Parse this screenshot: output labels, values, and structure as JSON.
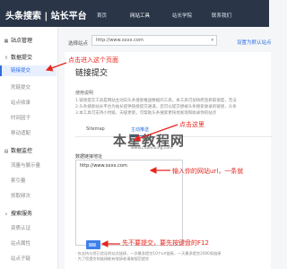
{
  "header": {
    "brand": "头条搜索 | 站长平台",
    "nav": [
      "首页",
      "网站工具",
      "站长学院",
      "联系我们"
    ],
    "active_nav": 1
  },
  "sidebar": {
    "sections": [
      {
        "label": "站点管理",
        "icon": "grid-icon"
      },
      {
        "label": "数据提交",
        "icon": "upload-icon",
        "items": [
          "链接提交",
          "死链提交",
          "站点收录",
          "时间因子",
          "移动适配"
        ]
      },
      {
        "label": "数据监控",
        "icon": "chart-icon",
        "items": [
          "流量与展示量",
          "索引量",
          "抓取频次"
        ]
      },
      {
        "label": "搜索服务",
        "icon": "search-icon",
        "items": [
          "资质认证",
          "站点属性",
          "站点子链"
        ]
      }
    ]
  },
  "site_bar": {
    "label": "选择站点",
    "value": "http://www.xxxx.com",
    "link": "设置为默认站点"
  },
  "page": {
    "title": "链接提交",
    "usage_label": "使用说明",
    "usage_lines": [
      "1.链接提交工具是网站主动向头条搜索推送数据的工具，本工具可加快爬虫抓取速度，无法",
      "2.头条搜索站长平台为站长提供链接提交通道，您可以提交想被头条搜索收录的链接，头条",
      "3.本工具可支持小时级、天级更新，可帮助头条搜索更快地发现和收录你的站点"
    ],
    "tabs": [
      "Sitemap",
      "主动推送"
    ],
    "input_label": "数据链接地址",
    "url_value": "http://www.xxxx.com",
    "notes": [
      "· 仅支持与您已验证的站点链接，一次最多提交10个url链接，一天最多提交2000条链接",
      "· 为了您提交的链接能有效接收请按规范提交"
    ],
    "watermark": "本星教程网",
    "watermark_sub": "www.cnbenxing.com"
  },
  "annotations": {
    "step1": "点击进入这个页面",
    "step2": "点击这里",
    "step3": "输入你的网站url，一条就",
    "step4": "先不要提交，要先按键盘的F12",
    "color": "#e8251c"
  },
  "colors": {
    "accent": "#2e6fe0",
    "topbar": "#2a3648",
    "annotation": "#e8251c"
  }
}
